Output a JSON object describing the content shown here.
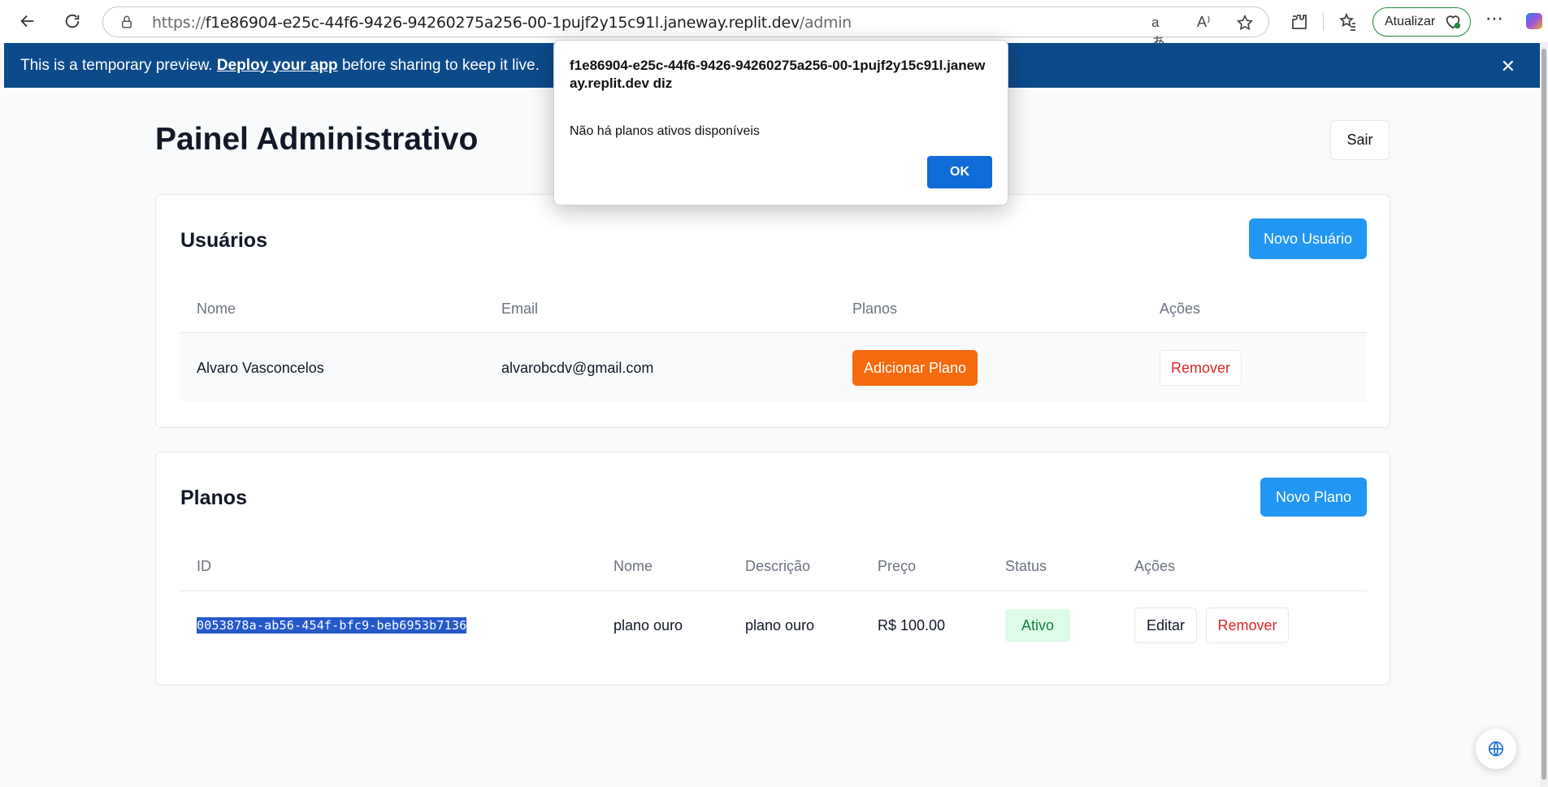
{
  "browser": {
    "url_prefix": "https://",
    "url_host": "f1e86904-e25c-44f6-9426-94260275a256-00-1pujf2y15c91l.janeway.replit.dev",
    "url_path": "/admin",
    "update_label": "Atualizar",
    "read_aloud_icon": "A⁾",
    "translate_icon": "aあ"
  },
  "banner": {
    "text_before": "This is a temporary preview. ",
    "link": "Deploy your app",
    "text_after": " before sharing to keep it live.",
    "close": "✕"
  },
  "page": {
    "title": "Painel Administrativo",
    "logout_label": "Sair"
  },
  "users": {
    "title": "Usuários",
    "new_label": "Novo Usuário",
    "columns": [
      "Nome",
      "Email",
      "Planos",
      "Ações"
    ],
    "rows": [
      {
        "name": "Alvaro Vasconcelos",
        "email": "alvarobcdv@gmail.com",
        "add_plan": "Adicionar Plano",
        "remove": "Remover"
      }
    ]
  },
  "plans": {
    "title": "Planos",
    "new_label": "Novo Plano",
    "columns": [
      "ID",
      "Nome",
      "Descrição",
      "Preço",
      "Status",
      "Ações"
    ],
    "rows": [
      {
        "id": "0053878a-ab56-454f-bfc9-beb6953b7136",
        "name": "plano ouro",
        "description": "plano ouro",
        "price": "R$ 100.00",
        "status": "Ativo",
        "edit": "Editar",
        "remove": "Remover"
      }
    ]
  },
  "dialog": {
    "origin": "f1e86904-e25c-44f6-9426-94260275a256-00-1pujf2y15c91l.janeway.replit.dev diz",
    "message": "Não há planos ativos disponíveis",
    "ok_label": "OK"
  },
  "colors": {
    "banner": "#0c4a8a",
    "primary": "#2196f3",
    "orange": "#f46a0c",
    "danger": "#dc2626",
    "active_badge": "#dcfce7"
  }
}
